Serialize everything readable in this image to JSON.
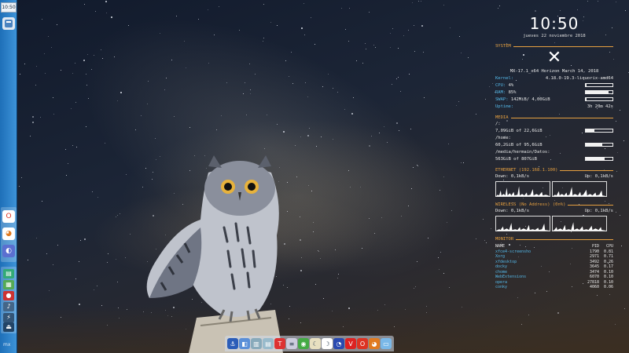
{
  "panel": {
    "clock": "10:50"
  },
  "conky": {
    "time": "10:50",
    "date": "jueves 22 noviembre 2018",
    "system": {
      "header": "SYSTEM",
      "release": "MX-17.1_x64 Horizon March 14, 2018",
      "kernel_label": "Kernel:",
      "kernel_value": "4.18.0-19.3-liquorix-amd64",
      "cpu_label": "CPU:",
      "cpu_value": "4%",
      "cpu_fraction": 0.04,
      "ram_label": "RAM:",
      "ram_value": "85%",
      "ram_fraction": 0.85,
      "swap_label": "SWAP:",
      "swap_value": "142MiB/ 4,00GiB",
      "swap_fraction": 0.035,
      "uptime_label": "Uptime:",
      "uptime_value": "3h 20m 42s"
    },
    "media": {
      "header": "MEDIA",
      "mounts": [
        {
          "path": "/:",
          "usage": "7,09GiB of 22,6GiB",
          "fraction": 0.31
        },
        {
          "path": "/home:",
          "usage": "60,2GiB of 95,6GiB",
          "fraction": 0.63
        },
        {
          "path": "/media/hermain/Datos:",
          "usage": "563GiB of 807GiB",
          "fraction": 0.7
        }
      ]
    },
    "ethernet": {
      "header": "ETHERNET (192.168.1.100)",
      "down": "Down: 0,1kB/s",
      "up": "Up: 0,1kB/s"
    },
    "wireless": {
      "header": "WIRELESS (No Address) (0n%)",
      "down": "Down: 0,1kB/s",
      "up": "Up: 0,1kB/s"
    },
    "monitor": {
      "header": "MONITOR",
      "columns": [
        "NAME",
        "PID",
        "CPU"
      ],
      "rows": [
        {
          "name": "xfce4-screensho",
          "pid": "1790",
          "cpu": "0.81"
        },
        {
          "name": "Xorg",
          "pid": "2971",
          "cpu": "0.71"
        },
        {
          "name": "xfdesktop",
          "pid": "3492",
          "cpu": "0.26"
        },
        {
          "name": "docky",
          "pid": "3645",
          "cpu": "0.17"
        },
        {
          "name": "chome",
          "pid": "3474",
          "cpu": "0.10"
        },
        {
          "name": "WebExtensions",
          "pid": "6070",
          "cpu": "0.10"
        },
        {
          "name": "opera",
          "pid": "27818",
          "cpu": "0.10"
        },
        {
          "name": "conky",
          "pid": "4060",
          "cpu": "0.06"
        }
      ]
    }
  },
  "colors": {
    "section_header": "#e6a040",
    "label": "#54b8e8",
    "panel": "#2f85cc"
  },
  "dock_icons": [
    "anchor-icon",
    "finder-icon",
    "files-icon",
    "notes-icon",
    "text-editor-icon",
    "document-icon",
    "feed-icon",
    "app-green-icon",
    "moon-icon",
    "chrome-icon",
    "vivaldi-icon",
    "opera-icon",
    "firefox-icon",
    "desktop-icon"
  ]
}
